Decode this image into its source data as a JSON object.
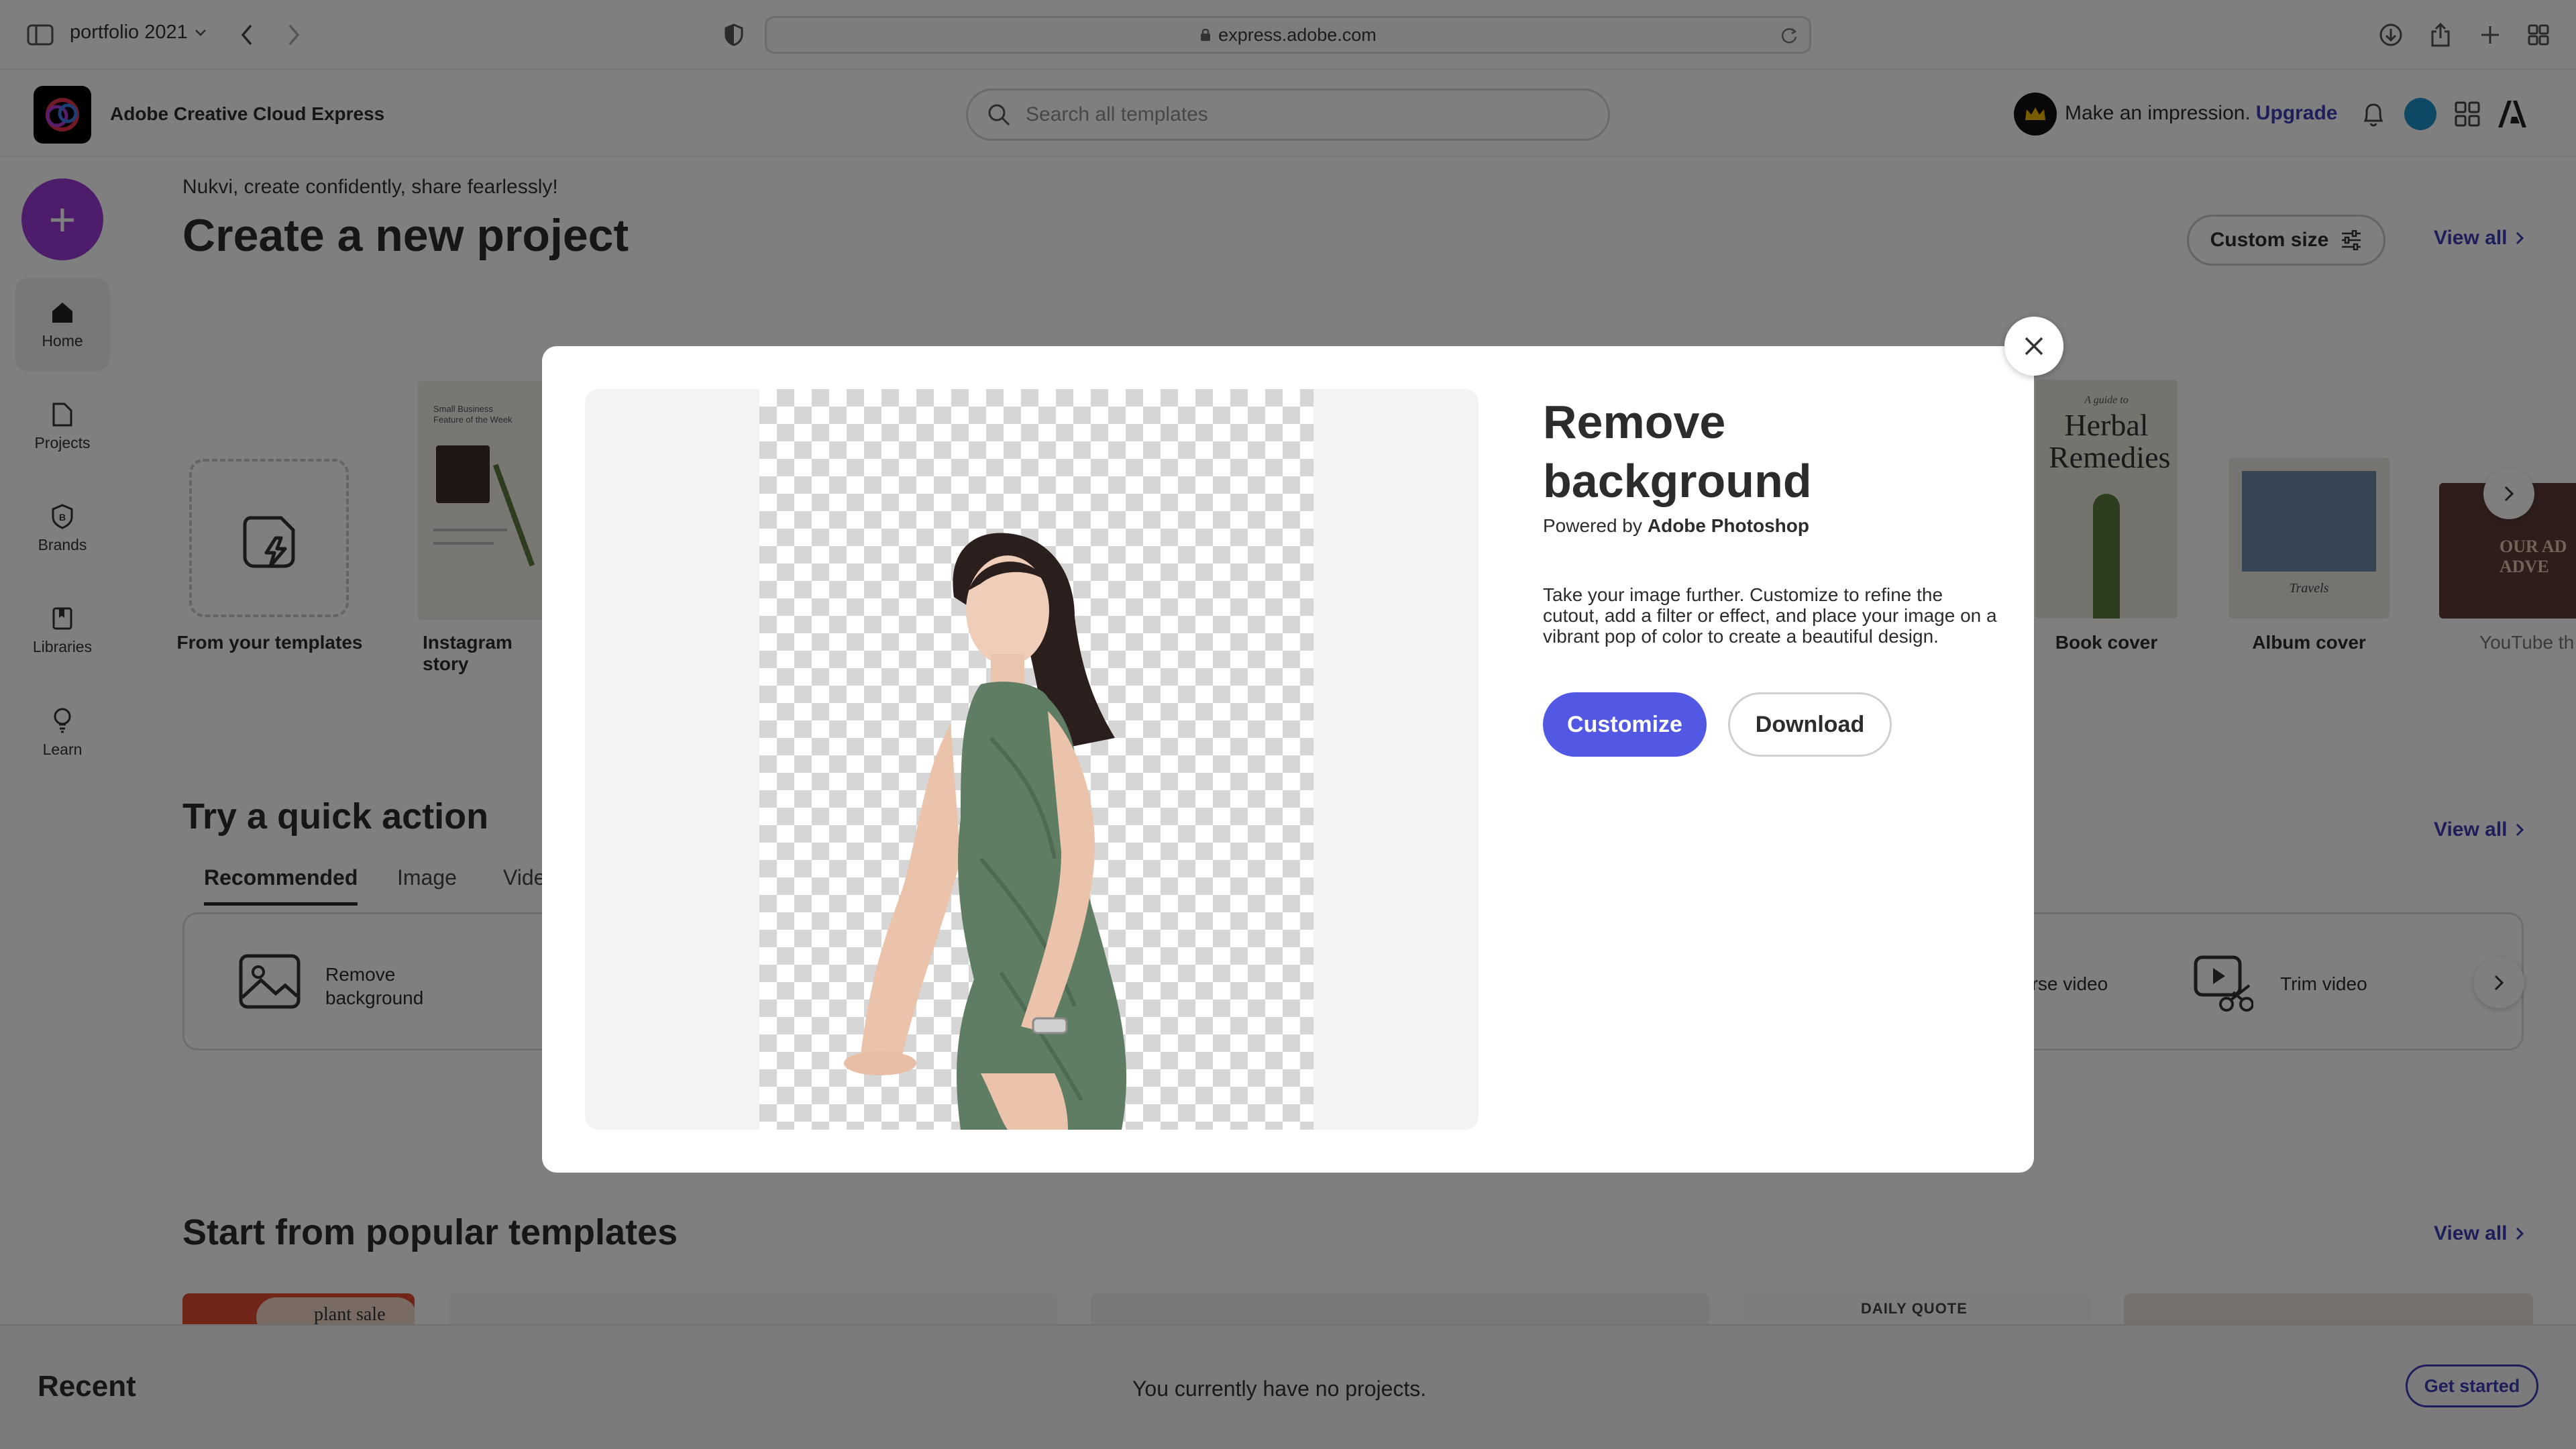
{
  "browser": {
    "tab_group": "portfolio 2021",
    "url": "express.adobe.com"
  },
  "app": {
    "name": "Adobe Creative Cloud Express",
    "search_placeholder": "Search all templates",
    "promo_text": "Make an impression.",
    "upgrade_label": "Upgrade"
  },
  "sidebar": {
    "create_label": "+",
    "items": [
      {
        "label": "Home",
        "icon": "home-icon"
      },
      {
        "label": "Projects",
        "icon": "file-icon"
      },
      {
        "label": "Brands",
        "icon": "brand-icon"
      },
      {
        "label": "Libraries",
        "icon": "library-icon"
      },
      {
        "label": "Learn",
        "icon": "lightbulb-icon"
      }
    ]
  },
  "main": {
    "greeting": "Nukvi, create confidently, share fearlessly!",
    "create_title": "Create a new project",
    "custom_size_label": "Custom size",
    "view_all": "View all",
    "template_types": [
      {
        "label": "From your templates"
      },
      {
        "label": "Instagram story"
      },
      {
        "label": "Book cover"
      },
      {
        "label": "Album cover"
      },
      {
        "label": "YouTube th"
      }
    ],
    "thumb_texts": {
      "instagram": "Small Business Feature of the Week",
      "book_small": "A guide to",
      "book_title": "Herbal Remedies",
      "album": "Travels",
      "youtube": "OUR AD ADVE"
    },
    "quick_action_title": "Try a quick action",
    "quick_tabs": [
      "Recommended",
      "Image",
      "Vide"
    ],
    "quick_actions": [
      {
        "label": "Remove background"
      },
      {
        "label": "erse video"
      },
      {
        "label": "Trim video"
      }
    ],
    "popular_title": "Start from popular templates",
    "popular_texts": {
      "plant": "plant sale",
      "quote": "DAILY QUOTE"
    },
    "recent_title": "Recent",
    "recent_empty": "You currently have no projects.",
    "get_started": "Get started"
  },
  "modal": {
    "title": "Remove background",
    "powered_by_prefix": "Powered by",
    "powered_by_brand": "Adobe Photoshop",
    "description": "Take your image further. Customize to refine the cutout, add a filter or effect, and place your image on a vibrant pop of color to create a beautiful design.",
    "customize_label": "Customize",
    "download_label": "Download"
  },
  "colors": {
    "accent": "#5258e4",
    "link": "#3c3cb5",
    "create_button": "#9b3bd6",
    "overlay": "rgba(0,0,0,0.5)"
  }
}
